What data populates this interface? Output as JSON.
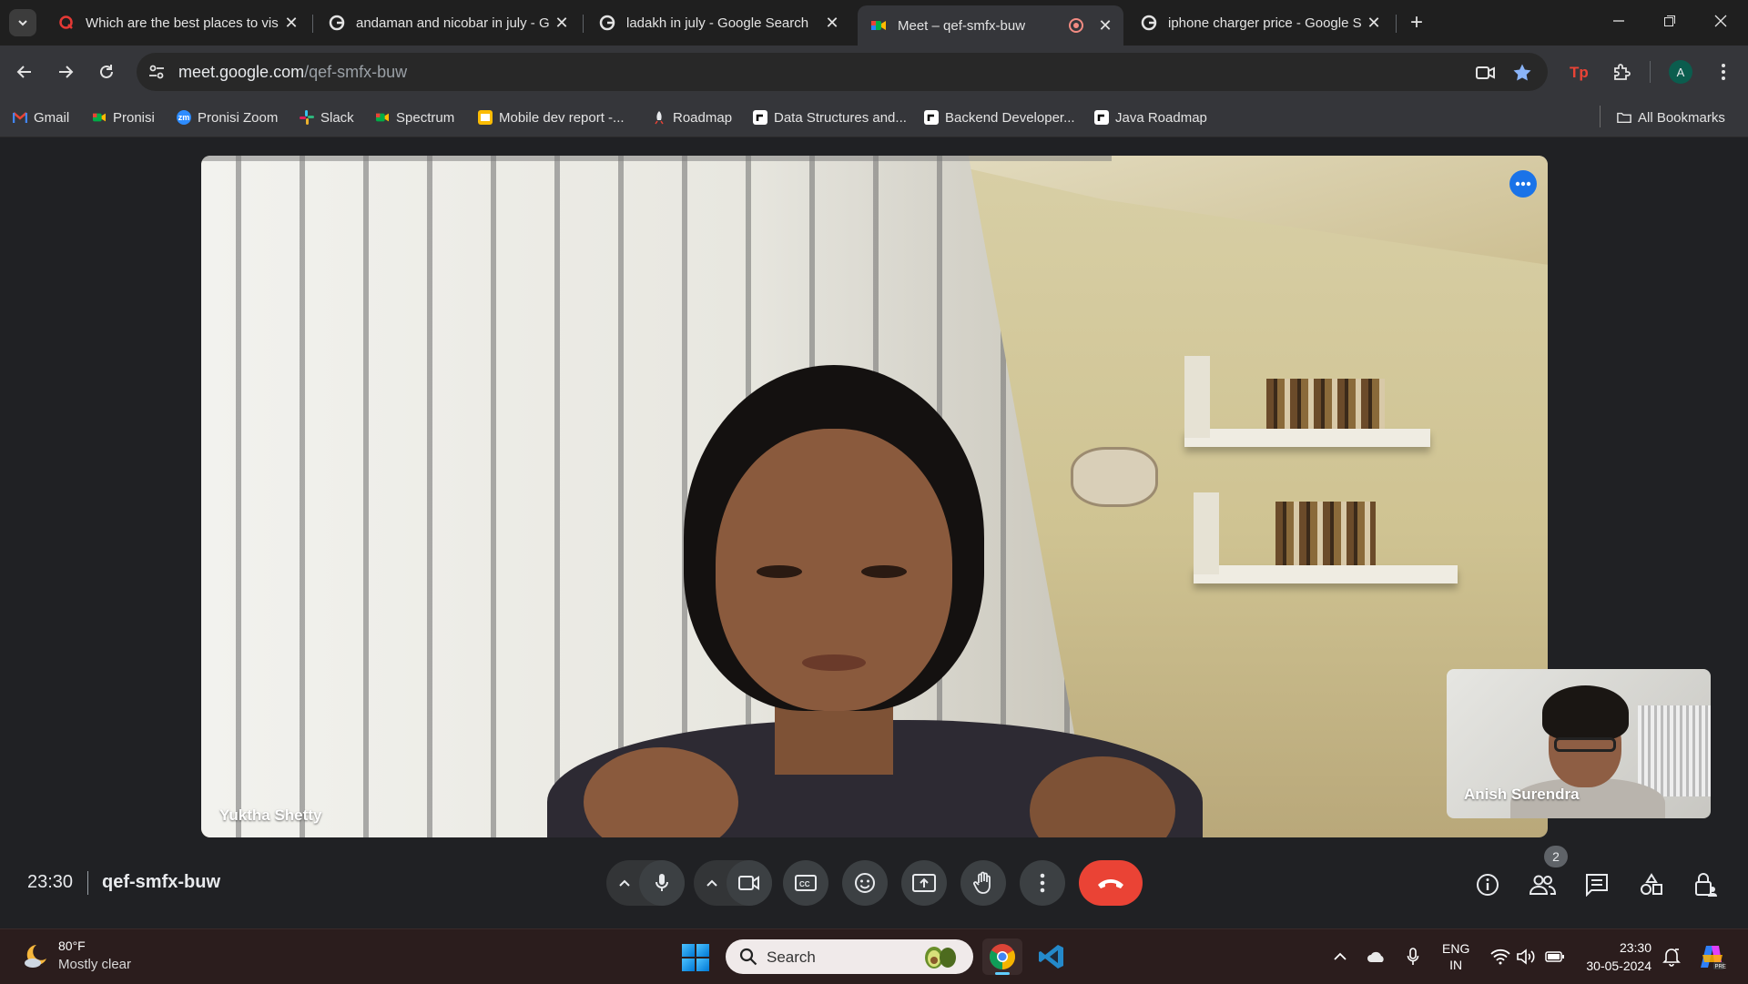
{
  "browser": {
    "tabs": [
      {
        "title": "Which are the best places to vis",
        "favicon": "quora-icon",
        "active": false
      },
      {
        "title": "andaman and nicobar in july - G",
        "favicon": "google-icon",
        "active": false
      },
      {
        "title": "ladakh in july - Google Search",
        "favicon": "google-icon",
        "active": false
      },
      {
        "title": "Meet – qef-smfx-buw",
        "favicon": "meet-icon",
        "active": true,
        "recording": true
      },
      {
        "title": "iphone charger price - Google S",
        "favicon": "google-icon",
        "active": false
      }
    ],
    "close_glyph": "✕",
    "new_tab_glyph": "+",
    "url_host": "meet.google.com",
    "url_path": "/qef-smfx-buw",
    "profile_initial": "A",
    "bookmarks": [
      {
        "label": "Gmail",
        "icon": "gmail-icon",
        "color": "#ea4335"
      },
      {
        "label": "Pronisi",
        "icon": "meet-icon",
        "color": "#34a853"
      },
      {
        "label": "Pronisi Zoom",
        "icon": "zoom-icon",
        "color": "#2d8cff",
        "glyph": "zm"
      },
      {
        "label": "Slack",
        "icon": "slack-icon",
        "color": "#e01e5a"
      },
      {
        "label": "Spectrum",
        "icon": "meet-icon",
        "color": "#34a853"
      },
      {
        "label": "Mobile dev report -...",
        "icon": "slides-icon",
        "color": "#fbbc04"
      },
      {
        "label": "Roadmap",
        "icon": "rocket-icon",
        "color": "#e8eaed"
      },
      {
        "label": "Data Structures and...",
        "icon": "roadmap-sh-icon",
        "color": "#ffffff"
      },
      {
        "label": "Backend Developer...",
        "icon": "roadmap-sh-icon",
        "color": "#ffffff"
      },
      {
        "label": "Java Roadmap",
        "icon": "roadmap-sh-icon",
        "color": "#ffffff"
      }
    ],
    "all_bookmarks": "All Bookmarks"
  },
  "meet": {
    "main_participant": "Yuktha Shetty",
    "self_participant": "Anish Surendra",
    "clock": "23:30",
    "meeting_code": "qef-smfx-buw",
    "people_count": "2",
    "colors": {
      "end_call": "#ea4335",
      "accent": "#1a73e8"
    }
  },
  "taskbar": {
    "temperature": "80°F",
    "weather": "Mostly clear",
    "search_label": "Search",
    "lang_line1": "ENG",
    "lang_line2": "IN",
    "time": "23:30",
    "date": "30-05-2024"
  }
}
